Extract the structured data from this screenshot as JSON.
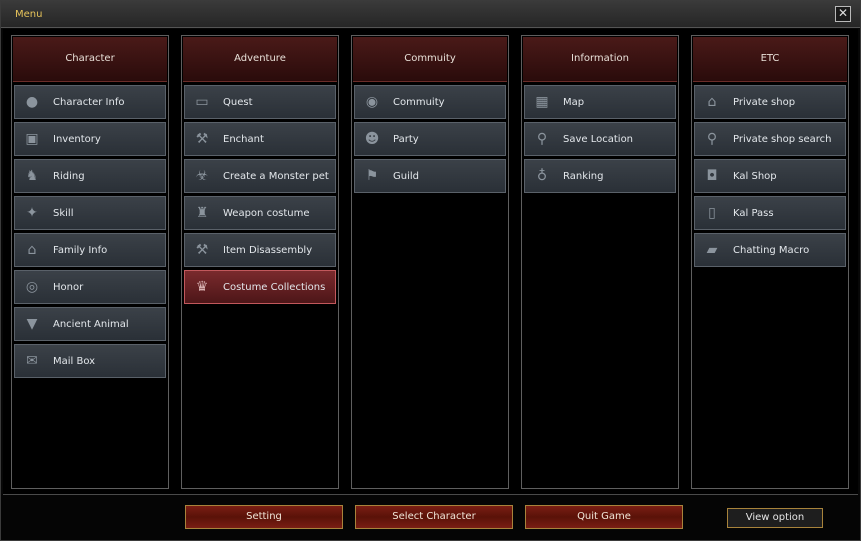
{
  "window": {
    "title": "Menu",
    "close_label": "✕"
  },
  "columns": [
    {
      "header": "Character",
      "items": [
        {
          "label": "Character Info",
          "icon": "person-icon"
        },
        {
          "label": "Inventory",
          "icon": "bag-icon"
        },
        {
          "label": "Riding",
          "icon": "mount-icon"
        },
        {
          "label": "Skill",
          "icon": "wand-icon"
        },
        {
          "label": "Family Info",
          "icon": "house-icon"
        },
        {
          "label": "Honor",
          "icon": "medal-icon"
        },
        {
          "label": "Ancient Animal",
          "icon": "eagle-icon"
        },
        {
          "label": "Mail Box",
          "icon": "mail-icon"
        }
      ]
    },
    {
      "header": "Adventure",
      "items": [
        {
          "label": "Quest",
          "icon": "scroll-icon"
        },
        {
          "label": "Enchant",
          "icon": "anvil-icon"
        },
        {
          "label": "Create a Monster pet",
          "icon": "dragon-icon"
        },
        {
          "label": "Weapon costume",
          "icon": "armor-icon"
        },
        {
          "label": "Item Disassembly",
          "icon": "hammer-icon"
        },
        {
          "label": "Costume Collections",
          "icon": "costume-icon",
          "active": true
        }
      ]
    },
    {
      "header": "Commuity",
      "items": [
        {
          "label": "Commuity",
          "icon": "chat-icon"
        },
        {
          "label": "Party",
          "icon": "party-icon"
        },
        {
          "label": "Guild",
          "icon": "flag-icon"
        }
      ]
    },
    {
      "header": "Information",
      "items": [
        {
          "label": "Map",
          "icon": "map-icon"
        },
        {
          "label": "Save Location",
          "icon": "pin-icon"
        },
        {
          "label": "Ranking",
          "icon": "trophy-icon"
        }
      ]
    },
    {
      "header": "ETC",
      "items": [
        {
          "label": "Private shop",
          "icon": "shop-icon"
        },
        {
          "label": "Private shop search",
          "icon": "search-icon"
        },
        {
          "label": "Kal Shop",
          "icon": "shopping-bag-icon"
        },
        {
          "label": "Kal Pass",
          "icon": "ticket-icon"
        },
        {
          "label": "Chatting Macro",
          "icon": "macro-icon"
        }
      ]
    }
  ],
  "footer": {
    "setting": "Setting",
    "select_character": "Select Character",
    "quit_game": "Quit Game",
    "view_option": "View option"
  }
}
